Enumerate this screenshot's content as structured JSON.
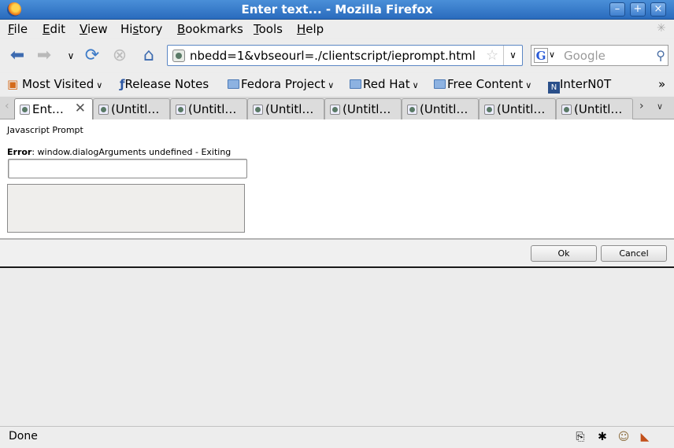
{
  "window": {
    "title": "Enter text... - Mozilla Firefox"
  },
  "menu": {
    "items": [
      {
        "first": "F",
        "rest": "ile"
      },
      {
        "first": "E",
        "rest": "dit"
      },
      {
        "first": "V",
        "rest": "iew"
      },
      {
        "pre": "Hi",
        "first": "s",
        "rest": "tory"
      },
      {
        "first": "B",
        "rest": "ookmarks"
      },
      {
        "first": "T",
        "rest": "ools"
      },
      {
        "first": "H",
        "rest": "elp"
      }
    ]
  },
  "nav": {
    "url": "nbedd=1&vbseourl=./clientscript/ieprompt.html",
    "search_placeholder": "Google",
    "search_engine": "G"
  },
  "bookmarks": {
    "items": [
      "Most Visited",
      "Release Notes",
      "Fedora Project",
      "Red Hat",
      "Free Content",
      "InterN0T"
    ],
    "overflow": "»"
  },
  "tabs": {
    "active": "Ent…",
    "others": [
      "(Untitl…",
      "(Untitl…",
      "(Untitl…",
      "(Untitl…",
      "(Untitl…",
      "(Untitl…",
      "(Untitl…"
    ]
  },
  "content": {
    "heading": "Javascript Prompt",
    "error_label": "Error",
    "error_message": ": window.dialogArguments undefined - Exiting",
    "ok_label": "Ok",
    "cancel_label": "Cancel"
  },
  "status": {
    "text": "Done"
  },
  "colors": {
    "titlebar": "#2a6bbd",
    "accent": "#5b87c4"
  }
}
